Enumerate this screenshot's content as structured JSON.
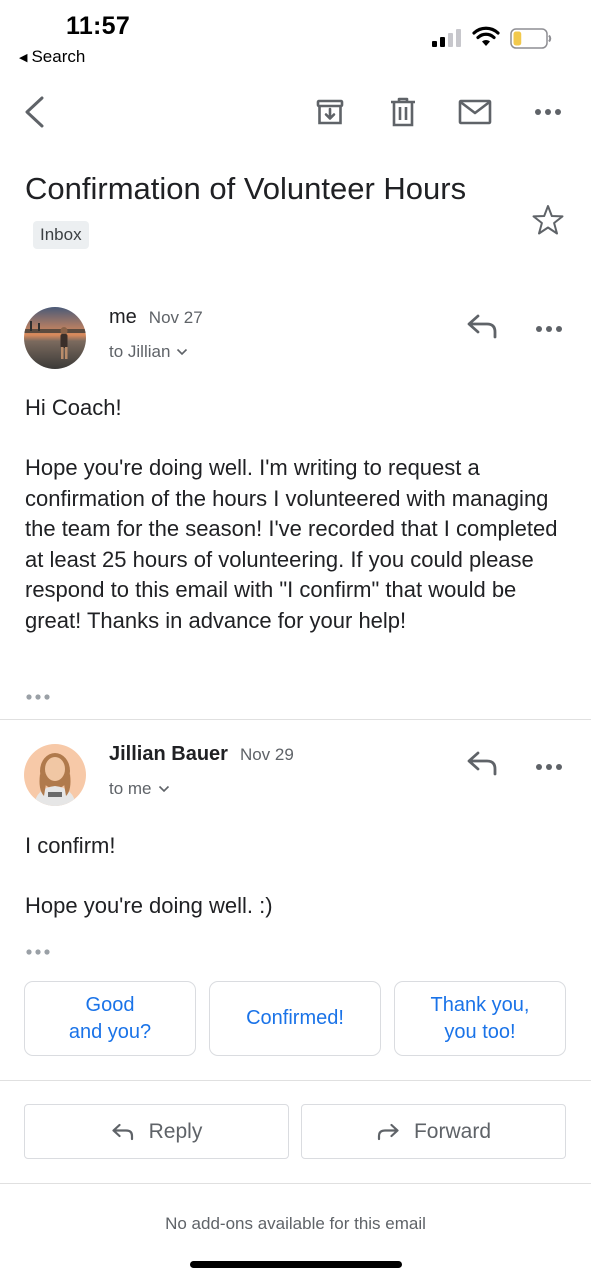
{
  "status_bar": {
    "time": "11:57",
    "back_label": "Search",
    "signal_bars_active": 2,
    "signal_bars_total": 4,
    "battery_level": 0.25,
    "battery_color": "#f2c94c"
  },
  "toolbar": {
    "icons": [
      "back-arrow-icon",
      "archive-icon",
      "trash-icon",
      "mail-icon",
      "more-icon"
    ]
  },
  "thread": {
    "subject": "Confirmation of Volunteer Hours",
    "label": "Inbox",
    "starred": false
  },
  "messages": [
    {
      "sender": "me",
      "date": "Nov 27",
      "recipient": "to Jillian",
      "greeting": "Hi Coach!",
      "body": "Hope you're doing well. I'm writing to request a confirmation of the hours I volunteered with managing the team for the season! I've recorded that I completed at least 25 hours of volunteering. If you could please respond to this email with \"I confirm\" that would be great! Thanks in advance for your help!"
    },
    {
      "sender": "Jillian Bauer",
      "date": "Nov 29",
      "recipient": "to me",
      "line1": "I confirm!",
      "line2": "Hope you're doing well. :)"
    }
  ],
  "smart_replies": [
    {
      "line1": "Good",
      "line2": "and you?"
    },
    {
      "line1": "Confirmed!"
    },
    {
      "line1": "Thank you,",
      "line2": "you too!"
    }
  ],
  "actions": {
    "reply_label": "Reply",
    "forward_label": "Forward"
  },
  "footer": {
    "addons_text": "No add-ons available for this email"
  },
  "colors": {
    "accent": "#1a73e8",
    "text_primary": "#202124",
    "text_secondary": "#5f6368",
    "icon": "#5f6368"
  }
}
